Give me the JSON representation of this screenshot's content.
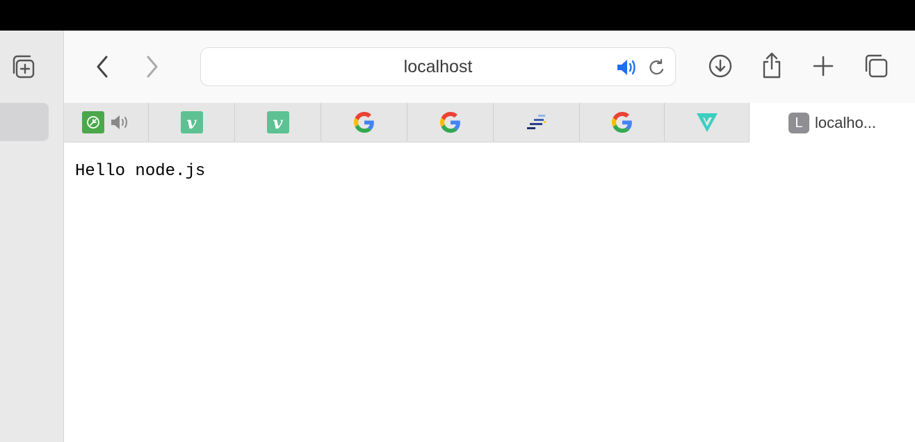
{
  "browser": {
    "url_field": {
      "text": "localhost"
    },
    "tabs": [
      {
        "icon": "green-leaf-icon",
        "audio_icon": "speaker-icon"
      },
      {
        "icon": "vimeo-icon",
        "glyph": "v"
      },
      {
        "icon": "vimeo-icon",
        "glyph": "v"
      },
      {
        "icon": "google-icon"
      },
      {
        "icon": "google-icon"
      },
      {
        "icon": "stacked-bars-icon"
      },
      {
        "icon": "google-icon"
      },
      {
        "icon": "teal-v-logo-icon"
      },
      {
        "icon": "letter-L-icon",
        "letter": "L",
        "title": "localho...",
        "active": true
      }
    ]
  },
  "page": {
    "body_text": "Hello node.js"
  },
  "colors": {
    "accent_blue": "#1e6ef0",
    "vimeo_green": "#5dc194",
    "teal_logo": "#3ccfc0"
  }
}
